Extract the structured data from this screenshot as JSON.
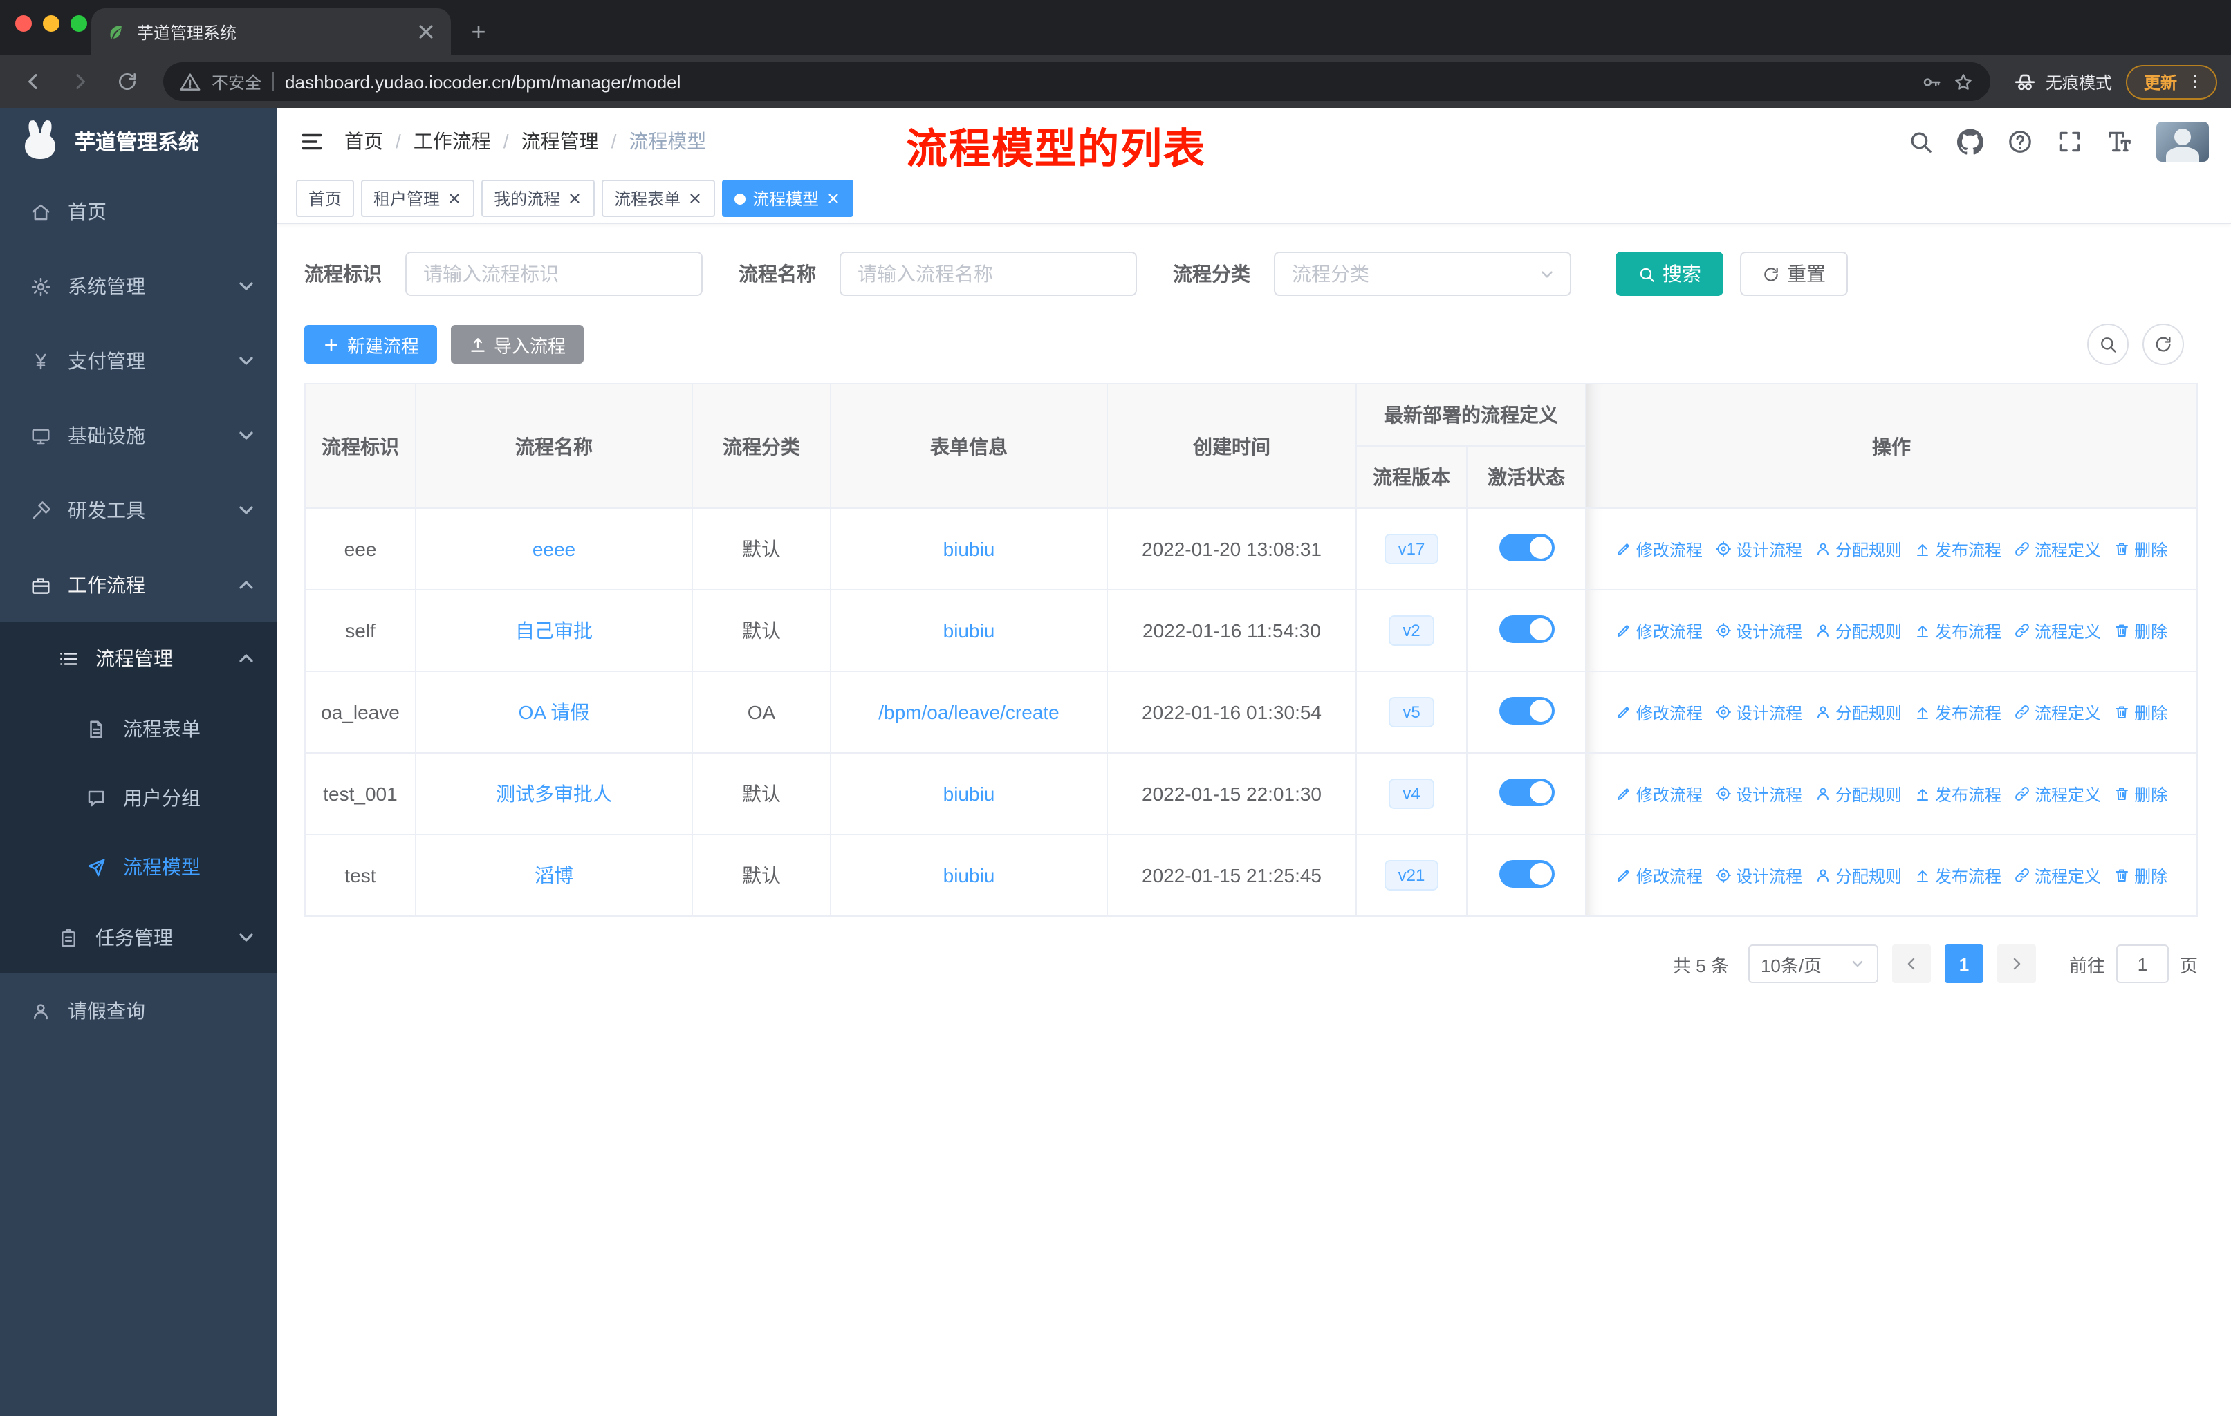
{
  "colors": {
    "primary": "#409eff",
    "search_button": "#12b1a3",
    "sidebar_bg": "#304156",
    "annotation_red": "#fe1b00",
    "active_tag": "#409eff"
  },
  "browser": {
    "tab_title": "芋道管理系统",
    "security_label": "不安全",
    "url": "dashboard.yudao.iocoder.cn/bpm/manager/model",
    "incognito_label": "无痕模式",
    "update_label": "更新"
  },
  "sidebar": {
    "logo_title": "芋道管理系统",
    "menu": [
      {
        "label": "首页",
        "icon": "home",
        "level": 1
      },
      {
        "label": "系统管理",
        "icon": "gear",
        "level": 1,
        "chevron": "down"
      },
      {
        "label": "支付管理",
        "icon": "yen",
        "level": 1,
        "chevron": "down"
      },
      {
        "label": "基础设施",
        "icon": "infra",
        "level": 1,
        "chevron": "down"
      },
      {
        "label": "研发工具",
        "icon": "tools",
        "level": 1,
        "chevron": "down"
      },
      {
        "label": "工作流程",
        "icon": "briefcase",
        "level": 1,
        "chevron": "up",
        "open": true
      },
      {
        "label": "流程管理",
        "icon": "list",
        "level": 2,
        "chevron": "up",
        "open": true
      },
      {
        "label": "流程表单",
        "icon": "doc",
        "level": 3
      },
      {
        "label": "用户分组",
        "icon": "chat",
        "level": 3
      },
      {
        "label": "流程模型",
        "icon": "send",
        "level": 3,
        "active": true
      },
      {
        "label": "任务管理",
        "icon": "task",
        "level": 2,
        "chevron": "down"
      },
      {
        "label": "请假查询",
        "icon": "person",
        "level": 1
      }
    ]
  },
  "header": {
    "breadcrumb": [
      "首页",
      "工作流程",
      "流程管理",
      "流程模型"
    ],
    "annotation": "流程模型的列表"
  },
  "tags": [
    {
      "label": "首页",
      "closable": false,
      "active": false
    },
    {
      "label": "租户管理",
      "closable": true,
      "active": false
    },
    {
      "label": "我的流程",
      "closable": true,
      "active": false
    },
    {
      "label": "流程表单",
      "closable": true,
      "active": false
    },
    {
      "label": "流程模型",
      "closable": true,
      "active": true
    }
  ],
  "filter": {
    "fields": [
      {
        "label": "流程标识",
        "placeholder": "请输入流程标识",
        "type": "input"
      },
      {
        "label": "流程名称",
        "placeholder": "请输入流程名称",
        "type": "input"
      },
      {
        "label": "流程分类",
        "placeholder": "流程分类",
        "type": "select"
      }
    ],
    "search": "搜索",
    "reset": "重置"
  },
  "actions_bar": {
    "create": "新建流程",
    "import": "导入流程"
  },
  "table": {
    "columns": {
      "key": "流程标识",
      "name": "流程名称",
      "category": "流程分类",
      "form": "表单信息",
      "created": "创建时间",
      "version": "流程版本",
      "status": "激活状态",
      "ops": "操作"
    },
    "group_header": "最新部署的流程定义",
    "row_actions": [
      {
        "label": "修改流程",
        "icon": "edit"
      },
      {
        "label": "设计流程",
        "icon": "design"
      },
      {
        "label": "分配规则",
        "icon": "assign"
      },
      {
        "label": "发布流程",
        "icon": "publish"
      },
      {
        "label": "流程定义",
        "icon": "link"
      },
      {
        "label": "删除",
        "icon": "trash"
      }
    ],
    "rows": [
      {
        "key": "eee",
        "name": "eeee",
        "category": "默认",
        "form": "biubiu",
        "created": "2022-01-20 13:08:31",
        "version": "v17",
        "active": true
      },
      {
        "key": "self",
        "name": "自己审批",
        "category": "默认",
        "form": "biubiu",
        "created": "2022-01-16 11:54:30",
        "version": "v2",
        "active": true
      },
      {
        "key": "oa_leave",
        "name": "OA 请假",
        "category": "OA",
        "form": "/bpm/oa/leave/create",
        "created": "2022-01-16 01:30:54",
        "version": "v5",
        "active": true
      },
      {
        "key": "test_001",
        "name": "测试多审批人",
        "category": "默认",
        "form": "biubiu",
        "created": "2022-01-15 22:01:30",
        "version": "v4",
        "active": true
      },
      {
        "key": "test",
        "name": "滔博",
        "category": "默认",
        "form": "biubiu",
        "created": "2022-01-15 21:25:45",
        "version": "v21",
        "active": true
      }
    ]
  },
  "pagination": {
    "total": "共 5 条",
    "page_size": "10条/页",
    "current_page": "1",
    "goto_label": "前往",
    "goto_value": "1",
    "page_unit": "页"
  }
}
